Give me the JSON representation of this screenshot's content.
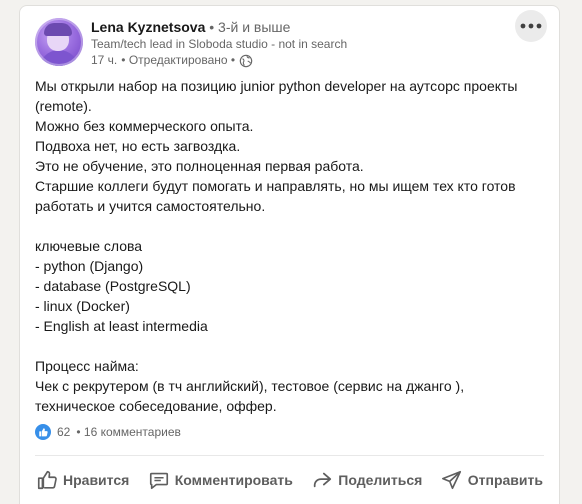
{
  "author": {
    "name": "Lena Kyznetsova",
    "degree": "• 3-й и выше",
    "headline": "Team/tech lead in Sloboda studio - not in search",
    "time": "17 ч.",
    "edited": "• Отредактировано •",
    "visibility_icon": "globe-icon"
  },
  "post": {
    "lines": [
      "Мы открыли набор на позицию junior python developer на аутсорс проекты",
      "(remote).",
      "Можно без коммерческого опыта.",
      "Подвоха нет, но есть загвоздка.",
      "Это не обучение, это полноценная первая работа.",
      "Старшие коллеги будут помогать и направлять, но мы ищем тех кто готов",
      "работать и учится самостоятельно.",
      "",
      "ключевые слова",
      "- python (Django)",
      "- database (PostgreSQL)",
      "- linux (Docker)",
      "- English at least intermedia",
      "",
      "Процесс найма:",
      "Чек с рекрутером (в тч английский), тестовое (сервис на джанго ),",
      "техническое собеседование, оффер."
    ]
  },
  "social": {
    "reactions": "62",
    "comments": "• 16 комментариев",
    "reaction_icon": "like-reaction-icon"
  },
  "actions": {
    "like": "Нравится",
    "comment": "Комментировать",
    "share": "Поделиться",
    "send": "Отправить"
  },
  "colors": {
    "accent": "#378fe9",
    "text": "#191919",
    "muted": "#666666",
    "action_text": "#5e5e5e"
  }
}
